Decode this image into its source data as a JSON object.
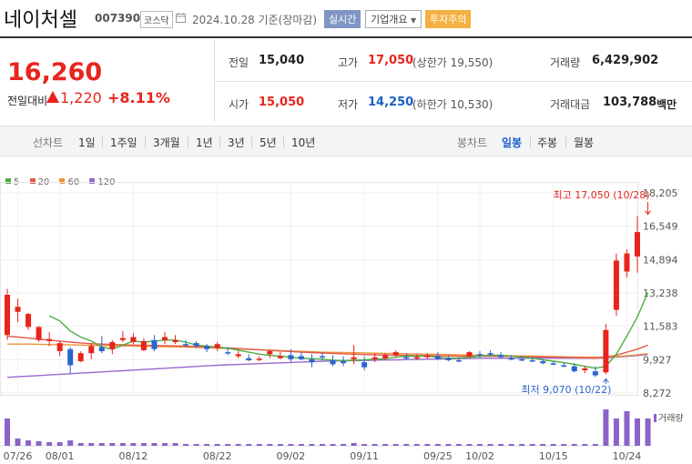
{
  "header": {
    "company": "네이처셀",
    "code": "007390",
    "market": "코스닥",
    "date": "2024.10.28",
    "date_suffix": "기준(장마감)",
    "realtime_button": "실시간",
    "company_info_button": "기업개요",
    "warning_badge": "투자주의"
  },
  "quote": {
    "price": "16,260",
    "change_label": "전일대비",
    "change_value": "1,220",
    "change_percent": "+8.11%"
  },
  "stats": {
    "prev_close": {
      "label": "전일",
      "value": "15,040"
    },
    "high": {
      "label": "고가",
      "value": "17,050",
      "sub": "(상한가 19,550)"
    },
    "volume": {
      "label": "거래량",
      "value": "6,429,902"
    },
    "open": {
      "label": "시가",
      "value": "15,050"
    },
    "low": {
      "label": "저가",
      "value": "14,250",
      "sub": "(하한가 10,530)"
    },
    "amount": {
      "label": "거래대금",
      "value": "103,788",
      "unit": "백만"
    }
  },
  "periods": {
    "line_label": "선차트",
    "line_items": [
      "1일",
      "1주일",
      "3개월",
      "1년",
      "3년",
      "5년",
      "10년"
    ],
    "candle_label": "봉차트",
    "candle_items": [
      "일봉",
      "주봉",
      "월봉"
    ],
    "active_candle": "일봉"
  },
  "legend": [
    {
      "label": "5",
      "color": "#4caf3f"
    },
    {
      "label": "20",
      "color": "#e05a4a"
    },
    {
      "label": "60",
      "color": "#f0923a"
    },
    {
      "label": "120",
      "color": "#9a6acb"
    }
  ],
  "volume_label": "거래량",
  "chart_data": {
    "type": "candlestick",
    "y_ticks": [
      "18,205",
      "16,549",
      "14,894",
      "13,238",
      "11,583",
      "9,927",
      "8,272"
    ],
    "ylim": [
      8272,
      18205
    ],
    "x_ticks": [
      {
        "label": "07/26",
        "index": 1
      },
      {
        "label": "08/01",
        "index": 5
      },
      {
        "label": "08/12",
        "index": 12
      },
      {
        "label": "08/22",
        "index": 20
      },
      {
        "label": "09/02",
        "index": 27
      },
      {
        "label": "09/11",
        "index": 34
      },
      {
        "label": "09/25",
        "index": 41
      },
      {
        "label": "10/02",
        "index": 45
      },
      {
        "label": "10/15",
        "index": 52
      },
      {
        "label": "10/24",
        "index": 59
      }
    ],
    "annotations": {
      "high": {
        "text": "최고 17,050 (10/28)",
        "index": 61,
        "value": 17050
      },
      "low": {
        "text": "최저 9,070 (10/22)",
        "index": 57,
        "value": 9070
      }
    },
    "candles": [
      {
        "o": 11150,
        "h": 13450,
        "l": 10900,
        "c": 13150
      },
      {
        "o": 12300,
        "h": 12950,
        "l": 11800,
        "c": 12550
      },
      {
        "o": 11550,
        "h": 12250,
        "l": 11400,
        "c": 12200
      },
      {
        "o": 10900,
        "h": 11600,
        "l": 10800,
        "c": 11550
      },
      {
        "o": 10850,
        "h": 11300,
        "l": 10600,
        "c": 10950
      },
      {
        "o": 10350,
        "h": 10850,
        "l": 10100,
        "c": 10750
      },
      {
        "o": 10450,
        "h": 10550,
        "l": 9250,
        "c": 9650
      },
      {
        "o": 9850,
        "h": 10350,
        "l": 9800,
        "c": 10250
      },
      {
        "o": 10250,
        "h": 10750,
        "l": 9950,
        "c": 10600
      },
      {
        "o": 10550,
        "h": 11100,
        "l": 10250,
        "c": 10350
      },
      {
        "o": 10450,
        "h": 10900,
        "l": 10200,
        "c": 10800
      },
      {
        "o": 10900,
        "h": 11350,
        "l": 10800,
        "c": 11000
      },
      {
        "o": 10800,
        "h": 11250,
        "l": 10700,
        "c": 11050
      },
      {
        "o": 10400,
        "h": 11000,
        "l": 10350,
        "c": 10850
      },
      {
        "o": 10900,
        "h": 11150,
        "l": 10350,
        "c": 10450
      },
      {
        "o": 10900,
        "h": 11300,
        "l": 10700,
        "c": 11050
      },
      {
        "o": 10800,
        "h": 11150,
        "l": 10700,
        "c": 10900
      },
      {
        "o": 10700,
        "h": 10900,
        "l": 10550,
        "c": 10650
      },
      {
        "o": 10750,
        "h": 10850,
        "l": 10500,
        "c": 10600
      },
      {
        "o": 10600,
        "h": 10700,
        "l": 10300,
        "c": 10450
      },
      {
        "o": 10500,
        "h": 10800,
        "l": 10350,
        "c": 10700
      },
      {
        "o": 10300,
        "h": 10550,
        "l": 10150,
        "c": 10250
      },
      {
        "o": 10100,
        "h": 10350,
        "l": 10000,
        "c": 10200
      },
      {
        "o": 10000,
        "h": 10200,
        "l": 9850,
        "c": 9900
      },
      {
        "o": 9950,
        "h": 10100,
        "l": 9850,
        "c": 9980
      },
      {
        "o": 10200,
        "h": 10450,
        "l": 10000,
        "c": 10350
      },
      {
        "o": 10000,
        "h": 10300,
        "l": 9950,
        "c": 10100
      },
      {
        "o": 10150,
        "h": 10450,
        "l": 9800,
        "c": 9950
      },
      {
        "o": 10100,
        "h": 10300,
        "l": 9900,
        "c": 9950
      },
      {
        "o": 9950,
        "h": 10200,
        "l": 9550,
        "c": 9800
      },
      {
        "o": 10100,
        "h": 10300,
        "l": 9900,
        "c": 10050
      },
      {
        "o": 9900,
        "h": 10150,
        "l": 9600,
        "c": 9700
      },
      {
        "o": 9850,
        "h": 10100,
        "l": 9600,
        "c": 9750
      },
      {
        "o": 9950,
        "h": 10650,
        "l": 9700,
        "c": 10050
      },
      {
        "o": 9800,
        "h": 10100,
        "l": 9400,
        "c": 9550
      },
      {
        "o": 9950,
        "h": 10250,
        "l": 9800,
        "c": 10050
      },
      {
        "o": 10000,
        "h": 10250,
        "l": 9900,
        "c": 10150
      },
      {
        "o": 10150,
        "h": 10400,
        "l": 10050,
        "c": 10300
      },
      {
        "o": 10050,
        "h": 10250,
        "l": 9950,
        "c": 10000
      },
      {
        "o": 10000,
        "h": 10200,
        "l": 9900,
        "c": 10050
      },
      {
        "o": 10050,
        "h": 10250,
        "l": 9950,
        "c": 10150
      },
      {
        "o": 10100,
        "h": 10300,
        "l": 9900,
        "c": 9950
      },
      {
        "o": 10000,
        "h": 10150,
        "l": 9850,
        "c": 9900
      },
      {
        "o": 9900,
        "h": 10050,
        "l": 9800,
        "c": 9850
      },
      {
        "o": 10100,
        "h": 10350,
        "l": 10000,
        "c": 10300
      },
      {
        "o": 10200,
        "h": 10350,
        "l": 10050,
        "c": 10150
      },
      {
        "o": 10250,
        "h": 10400,
        "l": 10100,
        "c": 10200
      },
      {
        "o": 10150,
        "h": 10300,
        "l": 10000,
        "c": 10050
      },
      {
        "o": 10000,
        "h": 10150,
        "l": 9900,
        "c": 9950
      },
      {
        "o": 9950,
        "h": 10100,
        "l": 9850,
        "c": 9900
      },
      {
        "o": 9900,
        "h": 10050,
        "l": 9800,
        "c": 9850
      },
      {
        "o": 9850,
        "h": 9950,
        "l": 9700,
        "c": 9750
      },
      {
        "o": 9750,
        "h": 9850,
        "l": 9650,
        "c": 9700
      },
      {
        "o": 9650,
        "h": 9800,
        "l": 9550,
        "c": 9600
      },
      {
        "o": 9600,
        "h": 9750,
        "l": 9300,
        "c": 9350
      },
      {
        "o": 9400,
        "h": 9600,
        "l": 9250,
        "c": 9500
      },
      {
        "o": 9350,
        "h": 9600,
        "l": 9070,
        "c": 9150
      },
      {
        "o": 9300,
        "h": 11700,
        "l": 9200,
        "c": 11400
      },
      {
        "o": 12400,
        "h": 15200,
        "l": 12100,
        "c": 14850
      },
      {
        "o": 14300,
        "h": 15400,
        "l": 14000,
        "c": 15200
      },
      {
        "o": 15050,
        "h": 17050,
        "l": 14250,
        "c": 16260
      }
    ],
    "ma5": [
      null,
      null,
      null,
      null,
      12100,
      11850,
      11350,
      11050,
      10850,
      10550,
      10450,
      10650,
      10850,
      10800,
      10850,
      10900,
      10900,
      10800,
      10650,
      10600,
      10550,
      10500,
      10400,
      10300,
      10200,
      10150,
      10100,
      10050,
      10000,
      9980,
      9950,
      9900,
      9880,
      9900,
      9920,
      9950,
      9980,
      10050,
      10100,
      10100,
      10100,
      10050,
      10000,
      10000,
      10050,
      10100,
      10150,
      10150,
      10100,
      10050,
      10000,
      9920,
      9850,
      9780,
      9700,
      9600,
      9500,
      9600,
      10200,
      11100,
      12050,
      13250
    ],
    "ma20": [
      11100,
      11050,
      11000,
      10950,
      10900,
      10850,
      10800,
      10760,
      10720,
      10700,
      10680,
      10670,
      10650,
      10640,
      10630,
      10620,
      10610,
      10600,
      10580,
      10560,
      10540,
      10510,
      10480,
      10450,
      10420,
      10390,
      10360,
      10330,
      10300,
      10280,
      10260,
      10240,
      10220,
      10200,
      10180,
      10170,
      10160,
      10150,
      10140,
      10130,
      10130,
      10120,
      10110,
      10100,
      10100,
      10100,
      10100,
      10100,
      10090,
      10080,
      10070,
      10060,
      10050,
      10040,
      10030,
      10020,
      10000,
      10050,
      10150,
      10300,
      10450,
      10650
    ],
    "ma60": [
      10700,
      10700,
      10700,
      10690,
      10680,
      10670,
      10660,
      10650,
      10640,
      10630,
      10620,
      10610,
      10600,
      10590,
      10580,
      10570,
      10560,
      10550,
      10540,
      10520,
      10500,
      10480,
      10460,
      10440,
      10420,
      10400,
      10380,
      10360,
      10340,
      10320,
      10300,
      10290,
      10280,
      10270,
      10260,
      10250,
      10240,
      10230,
      10220,
      10210,
      10200,
      10190,
      10180,
      10170,
      10160,
      10150,
      10140,
      10130,
      10120,
      10110,
      10100,
      10090,
      10080,
      10070,
      10060,
      10050,
      10050,
      10060,
      10080,
      10120,
      10170,
      10230
    ],
    "ma120": [
      9050,
      9080,
      9110,
      9140,
      9170,
      9200,
      9230,
      9260,
      9290,
      9320,
      9350,
      9380,
      9410,
      9440,
      9470,
      9500,
      9530,
      9560,
      9590,
      9620,
      9650,
      9670,
      9690,
      9710,
      9730,
      9750,
      9770,
      9790,
      9810,
      9830,
      9850,
      9860,
      9870,
      9880,
      9890,
      9900,
      9910,
      9920,
      9930,
      9940,
      9950,
      9960,
      9970,
      9980,
      9990,
      10000,
      10000,
      10000,
      10000,
      10000,
      10000,
      10000,
      10000,
      10000,
      10000,
      10000,
      10000,
      10020,
      10050,
      10090,
      10130,
      10180
    ],
    "volume": [
      30,
      8,
      6,
      5,
      4,
      4,
      6,
      3,
      3,
      3,
      3,
      3,
      3,
      3,
      3,
      3,
      3,
      2,
      2,
      2,
      2,
      2,
      2,
      2,
      2,
      2,
      2,
      2,
      2,
      2,
      2,
      2,
      2,
      3,
      2,
      2,
      2,
      2,
      2,
      2,
      2,
      2,
      2,
      2,
      2,
      2,
      2,
      2,
      2,
      2,
      2,
      2,
      2,
      2,
      2,
      2,
      2,
      40,
      30,
      38,
      30,
      30
    ]
  }
}
